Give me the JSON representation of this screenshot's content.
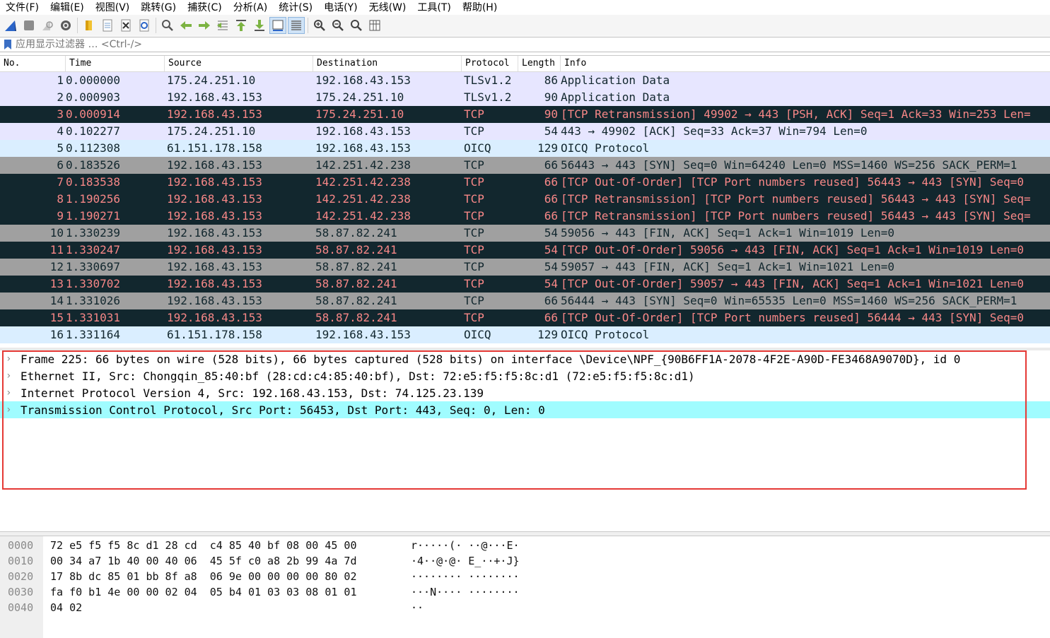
{
  "menu": [
    "文件(F)",
    "编辑(E)",
    "视图(V)",
    "跳转(G)",
    "捕获(C)",
    "分析(A)",
    "统计(S)",
    "电话(Y)",
    "无线(W)",
    "工具(T)",
    "帮助(H)"
  ],
  "toolbar": {
    "icons": [
      "shark-fin-start-icon",
      "stop-icon",
      "restart-icon",
      "options-gear-icon",
      "open-folder-icon",
      "save-file-icon",
      "close-file-icon",
      "reload-icon",
      "find-icon",
      "back-arrow-icon",
      "forward-arrow-icon",
      "goto-packet-icon",
      "first-packet-icon",
      "last-packet-icon",
      "autoscroll-icon",
      "colorize-icon",
      "zoom-in-icon",
      "zoom-out-icon",
      "zoom-normal-icon",
      "resize-columns-icon"
    ]
  },
  "filter": {
    "placeholder": "应用显示过滤器 … <Ctrl-/>"
  },
  "columns": [
    "No.",
    "Time",
    "Source",
    "Destination",
    "Protocol",
    "Length",
    "Info"
  ],
  "packets": [
    {
      "no": "1",
      "time": "0.000000",
      "src": "175.24.251.10",
      "dst": "192.168.43.153",
      "proto": "TLSv1.2",
      "len": "86",
      "info": "Application Data",
      "style": "lav"
    },
    {
      "no": "2",
      "time": "0.000903",
      "src": "192.168.43.153",
      "dst": "175.24.251.10",
      "proto": "TLSv1.2",
      "len": "90",
      "info": "Application Data",
      "style": "lav"
    },
    {
      "no": "3",
      "time": "0.000914",
      "src": "192.168.43.153",
      "dst": "175.24.251.10",
      "proto": "TCP",
      "len": "90",
      "info": "[TCP Retransmission] 49902 → 443 [PSH, ACK] Seq=1 Ack=33 Win=253 Len=",
      "style": "dark"
    },
    {
      "no": "4",
      "time": "0.102277",
      "src": "175.24.251.10",
      "dst": "192.168.43.153",
      "proto": "TCP",
      "len": "54",
      "info": "443 → 49902 [ACK] Seq=33 Ack=37 Win=794 Len=0",
      "style": "lav"
    },
    {
      "no": "5",
      "time": "0.112308",
      "src": "61.151.178.158",
      "dst": "192.168.43.153",
      "proto": "OICQ",
      "len": "129",
      "info": "OICQ Protocol",
      "style": "blue"
    },
    {
      "no": "6",
      "time": "0.183526",
      "src": "192.168.43.153",
      "dst": "142.251.42.238",
      "proto": "TCP",
      "len": "66",
      "info": "56443 → 443 [SYN] Seq=0 Win=64240 Len=0 MSS=1460 WS=256 SACK_PERM=1",
      "style": "gray"
    },
    {
      "no": "7",
      "time": "0.183538",
      "src": "192.168.43.153",
      "dst": "142.251.42.238",
      "proto": "TCP",
      "len": "66",
      "info": "[TCP Out-Of-Order] [TCP Port numbers reused] 56443 → 443 [SYN] Seq=0",
      "style": "dark"
    },
    {
      "no": "8",
      "time": "1.190256",
      "src": "192.168.43.153",
      "dst": "142.251.42.238",
      "proto": "TCP",
      "len": "66",
      "info": "[TCP Retransmission] [TCP Port numbers reused] 56443 → 443 [SYN] Seq=",
      "style": "dark"
    },
    {
      "no": "9",
      "time": "1.190271",
      "src": "192.168.43.153",
      "dst": "142.251.42.238",
      "proto": "TCP",
      "len": "66",
      "info": "[TCP Retransmission] [TCP Port numbers reused] 56443 → 443 [SYN] Seq=",
      "style": "dark"
    },
    {
      "no": "10",
      "time": "1.330239",
      "src": "192.168.43.153",
      "dst": "58.87.82.241",
      "proto": "TCP",
      "len": "54",
      "info": "59056 → 443 [FIN, ACK] Seq=1 Ack=1 Win=1019 Len=0",
      "style": "gray"
    },
    {
      "no": "11",
      "time": "1.330247",
      "src": "192.168.43.153",
      "dst": "58.87.82.241",
      "proto": "TCP",
      "len": "54",
      "info": "[TCP Out-Of-Order] 59056 → 443 [FIN, ACK] Seq=1 Ack=1 Win=1019 Len=0",
      "style": "dark"
    },
    {
      "no": "12",
      "time": "1.330697",
      "src": "192.168.43.153",
      "dst": "58.87.82.241",
      "proto": "TCP",
      "len": "54",
      "info": "59057 → 443 [FIN, ACK] Seq=1 Ack=1 Win=1021 Len=0",
      "style": "gray"
    },
    {
      "no": "13",
      "time": "1.330702",
      "src": "192.168.43.153",
      "dst": "58.87.82.241",
      "proto": "TCP",
      "len": "54",
      "info": "[TCP Out-Of-Order] 59057 → 443 [FIN, ACK] Seq=1 Ack=1 Win=1021 Len=0",
      "style": "dark"
    },
    {
      "no": "14",
      "time": "1.331026",
      "src": "192.168.43.153",
      "dst": "58.87.82.241",
      "proto": "TCP",
      "len": "66",
      "info": "56444 → 443 [SYN] Seq=0 Win=65535 Len=0 MSS=1460 WS=256 SACK_PERM=1",
      "style": "gray"
    },
    {
      "no": "15",
      "time": "1.331031",
      "src": "192.168.43.153",
      "dst": "58.87.82.241",
      "proto": "TCP",
      "len": "66",
      "info": "[TCP Out-Of-Order] [TCP Port numbers reused] 56444 → 443 [SYN] Seq=0",
      "style": "dark"
    },
    {
      "no": "16",
      "time": "1.331164",
      "src": "61.151.178.158",
      "dst": "192.168.43.153",
      "proto": "OICQ",
      "len": "129",
      "info": "OICQ Protocol",
      "style": "blue"
    }
  ],
  "details": [
    {
      "text": "Frame 225: 66 bytes on wire (528 bits), 66 bytes captured (528 bits) on interface \\Device\\NPF_{90B6FF1A-2078-4F2E-A90D-FE3468A9070D}, id 0",
      "selected": false
    },
    {
      "text": "Ethernet II, Src: Chongqin_85:40:bf (28:cd:c4:85:40:bf), Dst: 72:e5:f5:f5:8c:d1 (72:e5:f5:f5:8c:d1)",
      "selected": false
    },
    {
      "text": "Internet Protocol Version 4, Src: 192.168.43.153, Dst: 74.125.23.139",
      "selected": false
    },
    {
      "text": "Transmission Control Protocol, Src Port: 56453, Dst Port: 443, Seq: 0, Len: 0",
      "selected": true
    }
  ],
  "bytes": [
    {
      "offset": "0000",
      "hex": "72 e5 f5 f5 8c d1 28 cd  c4 85 40 bf 08 00 45 00",
      "ascii": "r·····(· ··@···E·"
    },
    {
      "offset": "0010",
      "hex": "00 34 a7 1b 40 00 40 06  45 5f c0 a8 2b 99 4a 7d",
      "ascii": "·4··@·@· E_··+·J}"
    },
    {
      "offset": "0020",
      "hex": "17 8b dc 85 01 bb 8f a8  06 9e 00 00 00 00 80 02",
      "ascii": "········ ········"
    },
    {
      "offset": "0030",
      "hex": "fa f0 b1 4e 00 00 02 04  05 b4 01 03 03 08 01 01",
      "ascii": "···N···· ········"
    },
    {
      "offset": "0040",
      "hex": "04 02",
      "ascii": "··"
    }
  ],
  "colors": {
    "dark_row_bg": "#12272e",
    "dark_row_fg": "#f78787",
    "lavender": "#e7e6ff",
    "gray": "#a0a0a0",
    "light_blue": "#daeeff",
    "selected_detail": "#a0fcff",
    "highlight_box": "#e53935"
  }
}
